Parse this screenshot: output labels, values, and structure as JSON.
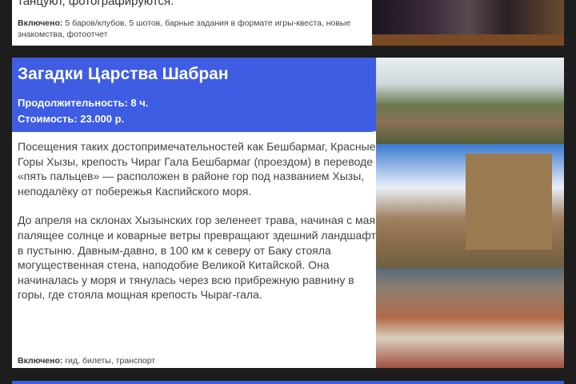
{
  "prev_card": {
    "cut_text": "танцуют, фотографируются.",
    "included_label": "Включено:",
    "included": "5 баров/клубов, 5 шотов, барные задания в формате игры-квеста, новые знакомства, фотоотчет"
  },
  "tour": {
    "title": "Загадки Царства Шабран",
    "duration": "Продолжительность: 8 ч.",
    "price": "Стоимость: 23.000 р.",
    "paragraphs": [
      "Посещения таких достопримечательностей как Бешбармаг, Красные Горы Хызы, крепость Чираг Гала Бешбармаг (проездом) в переводе «пять пальцев» — расположен в районе гор под названием Хызы, неподалёку от побережья Каспийского моря.",
      "До апреля на склонах Хызынских гор зеленеет трава, начиная с мая палящее солнце и коварные ветры превращают здешний ландшафт в пустыню. Давным-давно, в 100 км к северу от Баку стояла могущественная стена, наподобие Великой Китайской. Она начиналась у моря и тянулась через всю прибрежную равнину в горы, где стояла мощная крепость Чыраг-гала."
    ],
    "included_label": "Включено:",
    "included": "гид, билеты, транспорт"
  },
  "colors": {
    "accent": "#3e5de3",
    "background": "#1d1d1d"
  }
}
